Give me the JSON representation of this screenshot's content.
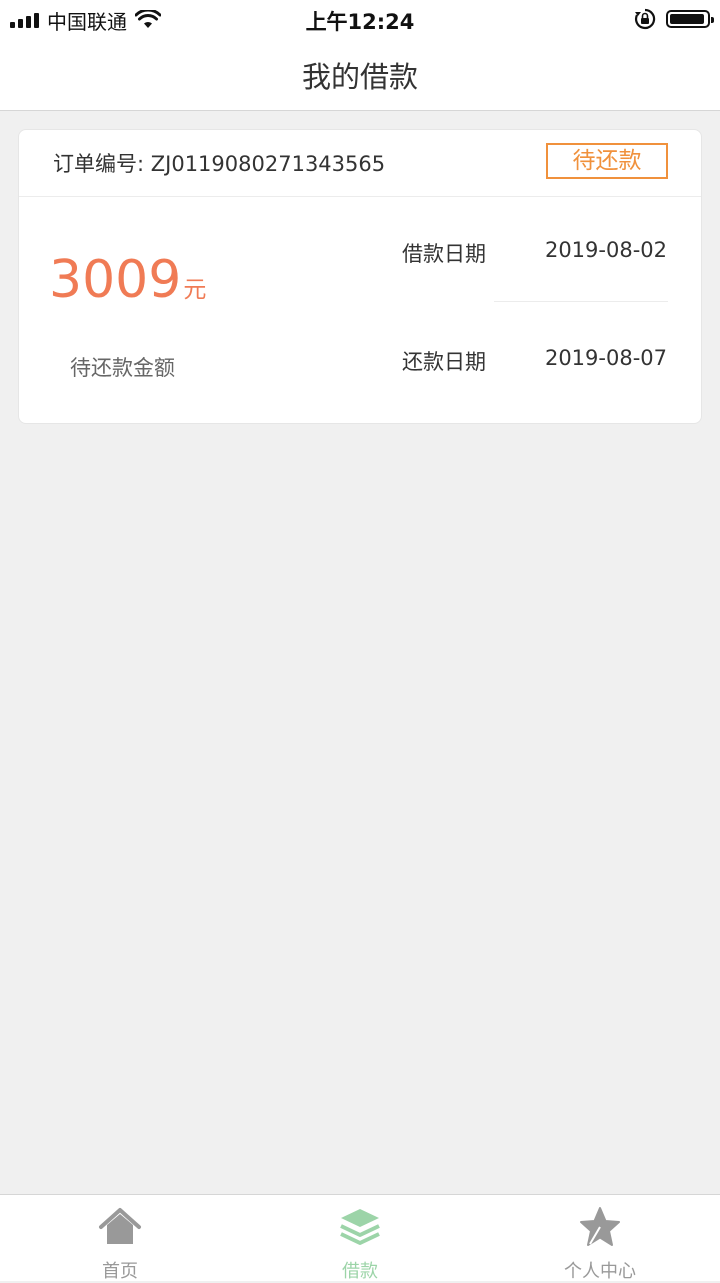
{
  "status_bar": {
    "carrier": "中国联通",
    "time": "上午12:24"
  },
  "navbar": {
    "title": "我的借款"
  },
  "loan_card": {
    "order_label": "订单编号: ZJ0119080271343565",
    "status": "待还款",
    "amount": "3009",
    "amount_unit": "元",
    "amount_label": "待还款金额",
    "loan_date_label": "借款日期",
    "loan_date": "2019-08-02",
    "repay_date_label": "还款日期",
    "repay_date": "2019-08-07"
  },
  "colors": {
    "accent_orange": "#f07b55",
    "status_orange": "#f0913c",
    "active_tab_green": "#9cd4a8",
    "inactive_tab_gray": "#999999"
  },
  "tabbar": {
    "active": "borrow",
    "items": [
      {
        "id": "home",
        "label": "首页",
        "icon": "home-icon"
      },
      {
        "id": "borrow",
        "label": "借款",
        "icon": "layers-icon"
      },
      {
        "id": "profile",
        "label": "个人中心",
        "icon": "star-icon"
      }
    ]
  }
}
